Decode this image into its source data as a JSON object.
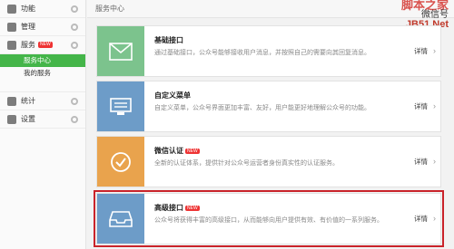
{
  "sidebar": {
    "groups": [
      {
        "label": "功能"
      },
      {
        "label": "管理"
      },
      {
        "label": "服务",
        "badge": "NEW",
        "items": [
          "服务中心",
          "我的服务"
        ]
      },
      {
        "label": "统计"
      },
      {
        "label": "设置"
      }
    ]
  },
  "header": {
    "title": "服务中心"
  },
  "watermark": {
    "line1": "脚本之家",
    "line2": "微信号",
    "line3": "JB51.Net"
  },
  "cards": [
    {
      "title": "基础接口",
      "desc": "通过基础接口，公众号能够接收用户消息，并按照自己的需要向其回复消息。",
      "detail": "详情",
      "color": "#7cc38d"
    },
    {
      "title": "自定义菜单",
      "desc": "自定义菜单，公众号界面更加丰富、友好，用户能更好地理解公众号的功能。",
      "detail": "详情",
      "color": "#6d9cc8"
    },
    {
      "title": "微信认证",
      "badge": "NEW",
      "desc": "全新的认证体系，提供针对公众号运营者身份真实性的认证服务。",
      "detail": "详情",
      "color": "#e9a34d"
    },
    {
      "title": "高级接口",
      "badge": "NEW",
      "desc": "公众号将获得丰富的高级接口，从而能够向用户提供有效、有价值的一系列服务。",
      "detail": "详情",
      "color": "#6d9cc8"
    }
  ],
  "icons": [
    "grid-icon",
    "folder-icon",
    "server-icon",
    "chart-icon",
    "gear-icon",
    "mail-icon",
    "menu-icon",
    "check-icon",
    "inbox-icon",
    "chevron-right-icon"
  ]
}
